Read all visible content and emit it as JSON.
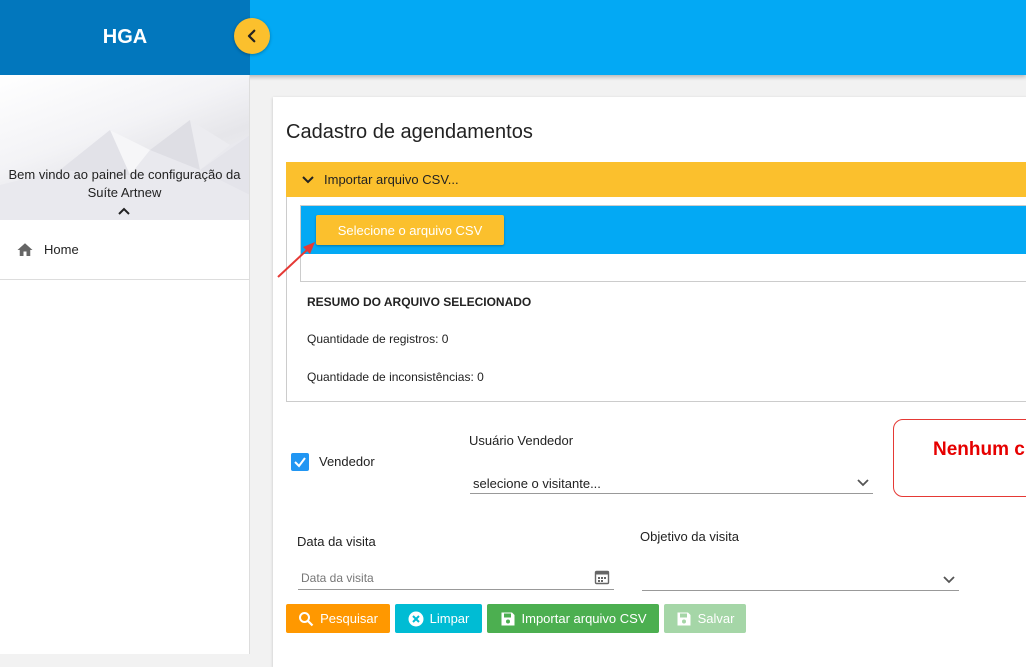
{
  "app": {
    "brand": "HGA"
  },
  "sidebar": {
    "welcome": "Bem vindo ao painel de configuração da Suíte Artnew",
    "items": [
      {
        "label": "Home",
        "icon": "home-icon"
      }
    ]
  },
  "page": {
    "title": "Cadastro de agendamentos"
  },
  "import": {
    "accordion_label": "Importar arquivo CSV...",
    "select_button": "Selecione o arquivo CSV",
    "summary_title": "RESUMO DO ARQUIVO SELECIONADO",
    "records_text": "Quantidade de registros: 0",
    "inconsistencies_text": "Quantidade de inconsistências: 0"
  },
  "form": {
    "vendedor_label": "Vendedor",
    "vendedor_checked": true,
    "usuario_label": "Usuário Vendedor",
    "usuario_value": "selecione o visitante...",
    "data_label": "Data da visita",
    "data_placeholder": "Data da visita",
    "objetivo_label": "Objetivo da visita",
    "objetivo_value": ""
  },
  "alert": {
    "text": "Nenhum ch"
  },
  "buttons": {
    "search": "Pesquisar",
    "clear": "Limpar",
    "import": "Importar arquivo CSV",
    "save": "Salvar"
  },
  "colors": {
    "primary": "#03a9f4",
    "primary_dark": "#0277bd",
    "accent_yellow": "#fbc02d",
    "orange": "#ff9800",
    "cyan": "#00bcd4",
    "green": "#4caf50",
    "green_disabled": "#a5d6a7",
    "error_red": "#e60000"
  }
}
